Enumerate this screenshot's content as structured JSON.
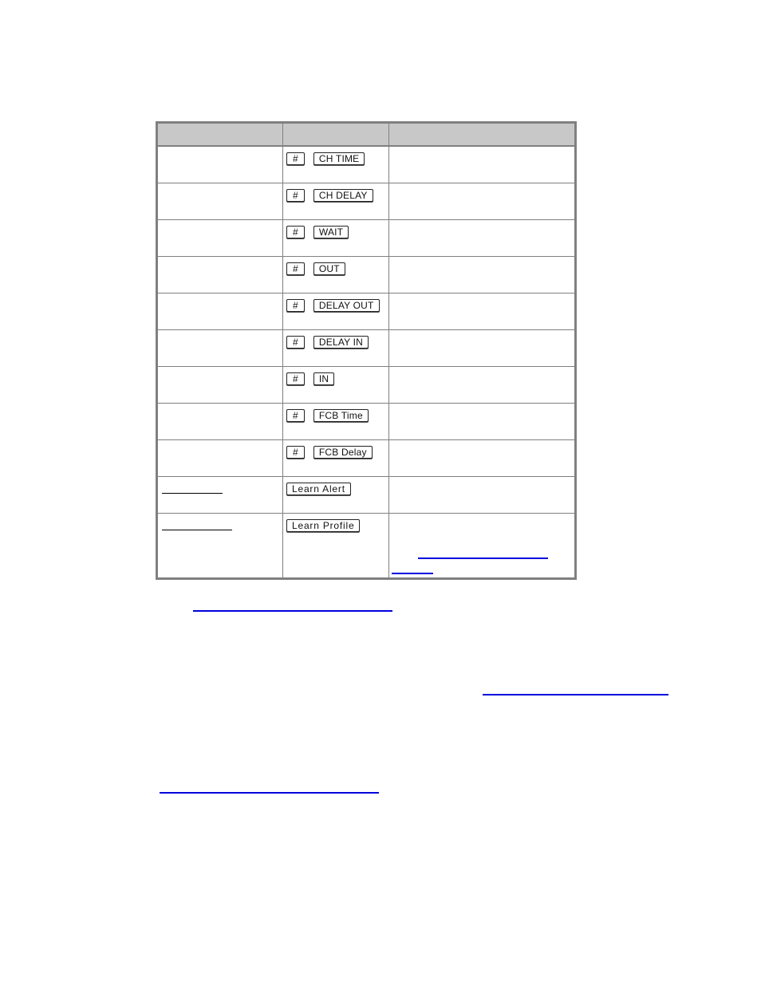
{
  "table": {
    "headers": [
      "",
      "",
      ""
    ],
    "rows": [
      {
        "feature": "",
        "keys": [
          "#",
          "CH TIME"
        ],
        "description": ""
      },
      {
        "feature": "",
        "keys": [
          "#",
          "CH DELAY"
        ],
        "description": ""
      },
      {
        "feature": "",
        "keys": [
          "#",
          "WAIT"
        ],
        "description": ""
      },
      {
        "feature": "",
        "keys": [
          "#",
          "OUT"
        ],
        "description": ""
      },
      {
        "feature": "",
        "keys": [
          "#",
          "DELAY OUT"
        ],
        "description": ""
      },
      {
        "feature": "",
        "keys": [
          "#",
          "DELAY IN"
        ],
        "description": ""
      },
      {
        "feature": "",
        "keys": [
          "#",
          "IN"
        ],
        "description": ""
      },
      {
        "feature": "",
        "keys": [
          "#",
          "FCB Time"
        ],
        "description": ""
      },
      {
        "feature": "",
        "keys": [
          "#",
          "FCB Delay"
        ],
        "description": ""
      },
      {
        "feature": "",
        "keys": [
          "Learn Alert"
        ],
        "description": ""
      },
      {
        "feature": "",
        "keys": [
          "Learn Profile"
        ],
        "description": ""
      }
    ]
  },
  "colors": {
    "header_bg": "#c8c8c8",
    "border": "#808080",
    "link": "#0000dd"
  }
}
